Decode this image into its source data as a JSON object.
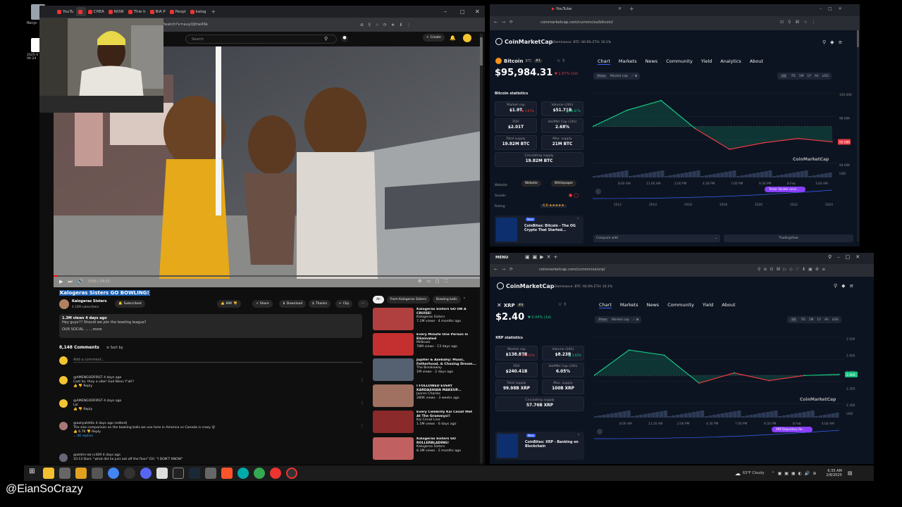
{
  "desktop": {
    "icons": [
      {
        "label": "Recyc"
      },
      {
        "label": "2025-0\n06-24"
      }
    ]
  },
  "youtube": {
    "tabs": [
      "YouTu",
      "",
      "CHEA",
      "NOW",
      "Thle h",
      "BiA P",
      "Peopl",
      "kalog"
    ],
    "url": "/watch?v=auyOjttw4Sk",
    "search_placeholder": "Search",
    "create_label": "Create",
    "video_title": "Kalogeras Sisters GO BOWLING!",
    "time": "0:00 / 24:51",
    "channel": "Kalogeras Sisters",
    "subscribers": "4.33M subscribers",
    "subscribed_label": "Subscribed",
    "likes": "89K",
    "share": "Share",
    "download": "Download",
    "thanks": "Thanks",
    "clip": "Clip",
    "views": "1.3M views 4 days ago",
    "desc1": "Hey guys!!! Should we join the bowling league?",
    "desc2": "OUR SOCIAL ... ...more",
    "comments_count": "8,148 Comments",
    "sort": "Sort by",
    "add_comment": "Add a comment...",
    "chips": [
      "All",
      "From Kalogeras Sisters",
      "Bowling balls"
    ],
    "comments": [
      {
        "user": "@AMENGODFIRST 4 days ago",
        "text": "Cast lie, they a vibe! God Bless Y'all!!",
        "reply": "Reply"
      },
      {
        "user": "@AMENGODFIRST 4 days ago",
        "text": "Lol",
        "reply": "Reply"
      },
      {
        "user": "@aaliyahtt6s 4 days ago (edited)",
        "text": "The size comparison on the bowling balls we use here in America vs Canada is crazy 😮",
        "reply": "Reply",
        "likes": "6.7K",
        "replies": "46 replies"
      },
      {
        "user": "@xtdmr-ak-rv309 4 days ago",
        "text": "10:13 Dani: \"what did he just eat off the floor\" Elli: \"I DON'T KNOW\"",
        "reply": ""
      }
    ],
    "recs": [
      {
        "title": "Kalogeras Sisters GO ON A CRUISE!",
        "meta": "Kalogeras Sisters\n7.2M views · 4 months ago",
        "dur": "38:23"
      },
      {
        "title": "Every Minute One Person Is Eliminated",
        "meta": "MrBeast\n78M views · 13 days ago",
        "dur": ""
      },
      {
        "title": "Jupiter & Asebahy: Music, Fatherhood, & Chasing Dream...",
        "meta": "The Breakaway\n1M views · 2 days ago",
        "dur": "2:16:07"
      },
      {
        "title": "I FOLLOWED EVERY KARDASHIAN MAKEUP...",
        "meta": "Jaoren Charles\n280K views · 3 weeks ago",
        "dur": ""
      },
      {
        "title": "Every Celebrity Kai Cenat Met At The Grammys!!",
        "meta": "Kai Cenat Live\n1.5M views · 6 days ago",
        "dur": ""
      },
      {
        "title": "Kalogeras Sisters GO ROLLERBLADING!",
        "meta": "Kalogeras Sisters\n8.3M views · 2 months ago",
        "dur": ""
      }
    ]
  },
  "btc": {
    "url": "coinmarketcap.com/currencies/bitcoin/",
    "logo": "CoinMarketCap",
    "dominance": "Dominance: BTC: 60.6% ETH: 10.1%",
    "nav": [
      "Chart",
      "Markets",
      "News",
      "Community",
      "Yield",
      "Analytics",
      "About"
    ],
    "name": "Bitcoin",
    "symbol": "BTC",
    "rank": "#1",
    "price": "$95,984.31",
    "change": "▼ 1.67% (1d)",
    "stats_title": "Bitcoin statistics",
    "stats": [
      {
        "k": "Market cap",
        "v": "$1.9T",
        "d": "▼ 1.67%"
      },
      {
        "k": "Volume (24h)",
        "v": "$51.71B",
        "d": "▲ 10.87%"
      },
      {
        "k": "FDV",
        "v": "$2.01T",
        "d": ""
      },
      {
        "k": "Vol/Mkt Cap (24h)",
        "v": "2.68%",
        "d": ""
      },
      {
        "k": "Total supply",
        "v": "19.82M BTC",
        "d": ""
      },
      {
        "k": "Max. supply",
        "v": "21M BTC",
        "d": ""
      },
      {
        "k": "Circulating supply",
        "v": "19.82M BTC",
        "d": ""
      }
    ],
    "website": "Website",
    "whitepaper": "Whitepaper",
    "socials": "Socials",
    "rating": "Rating",
    "rating_val": "4.6 ★★★★★",
    "promo_title": "CoinBites: Bitcoin - The OG Crypto That Started...",
    "promo_badge": "New",
    "tabs_price": [
      "Price",
      "Market cap"
    ],
    "ranges": [
      "1D",
      "7D",
      "1M",
      "1Y",
      "All",
      "LOG"
    ],
    "yaxis": [
      "100.00K",
      "98.00K",
      "96.00K",
      "94.00K"
    ],
    "xaxis": [
      "8:00 AM",
      "11:00 AM",
      "2:00 PM",
      "4:30 PM",
      "7:00 PM",
      "9:30 PM",
      "8 Feb",
      "3:00 AM"
    ],
    "price_tag": "95.98K",
    "xaxis2": [
      "2012",
      "2014",
      "2016",
      "2018",
      "2020",
      "2022",
      "2024"
    ],
    "event": "Trezor Senate consi...",
    "compare": "Compare with",
    "tradingview": "TradingView",
    "usd": "USD"
  },
  "xrp": {
    "url": "coinmarketcap.com/currencies/xrp/",
    "menu": "MENU",
    "logo": "CoinMarketCap",
    "dominance": "Dominance: BTC: 60.6% ETH: 10.1%",
    "nav": [
      "Chart",
      "Markets",
      "News",
      "Community",
      "Yield",
      "About"
    ],
    "name": "XRP",
    "symbol": "XRP",
    "rank": "#4",
    "price": "$2.40",
    "change": "▼ 0.04% (1d)",
    "stats_title": "XRP statistics",
    "stats": [
      {
        "k": "Market cap",
        "v": "$138.87B",
        "d": "▼ 0.04%"
      },
      {
        "k": "Volume (24h)",
        "v": "$8.23B",
        "d": "▲ 3.65%"
      },
      {
        "k": "FDV",
        "v": "$240.41B",
        "d": ""
      },
      {
        "k": "Vol/Mkt Cap (24h)",
        "v": "6.05%",
        "d": ""
      },
      {
        "k": "Total supply",
        "v": "99.98B XRP",
        "d": ""
      },
      {
        "k": "Max. supply",
        "v": "100B XRP",
        "d": ""
      },
      {
        "k": "Circulating supply",
        "v": "57.76B XRP",
        "d": ""
      }
    ],
    "promo_title": "CoinBites: XRP - Banking on Blockchain",
    "promo_badge": "New",
    "tabs_price": [
      "Price",
      "Market cap"
    ],
    "ranges": [
      "1D",
      "7D",
      "1M",
      "1Y",
      "All",
      "LOG"
    ],
    "yaxis": [
      "2.500",
      "2.450",
      "2.400",
      "2.350",
      "2.300"
    ],
    "xaxis": [
      "8:00 AM",
      "11:30 AM",
      "2:00 PM",
      "4:30 PM",
      "7:00 PM",
      "9:30 PM",
      "8 Feb",
      "4:00 AM"
    ],
    "price_tag": "2.404",
    "event": "XRP Depository Re...",
    "usd": "USD"
  },
  "tray": {
    "weather": "63°F Cloudy",
    "time": "6:35 AM",
    "date": "2/8/2025"
  },
  "handle": "@EianSoCrazy",
  "chart_data": [
    {
      "type": "line",
      "title": "Bitcoin price (1D)",
      "x": [
        "8:00 AM",
        "11:00 AM",
        "2:00 PM",
        "4:30 PM",
        "7:00 PM",
        "9:30 PM",
        "8 Feb",
        "3:00 AM"
      ],
      "values": [
        97400,
        98900,
        99800,
        97200,
        95300,
        95900,
        96300,
        95984
      ],
      "ylim": [
        94000,
        100500
      ]
    },
    {
      "type": "line",
      "title": "XRP price (1D)",
      "x": [
        "8:00 AM",
        "11:30 AM",
        "2:00 PM",
        "4:30 PM",
        "7:00 PM",
        "9:30 PM",
        "8 Feb",
        "4:00 AM"
      ],
      "values": [
        2.4,
        2.5,
        2.48,
        2.37,
        2.41,
        2.38,
        2.4,
        2.404
      ],
      "ylim": [
        2.29,
        2.55
      ]
    }
  ]
}
